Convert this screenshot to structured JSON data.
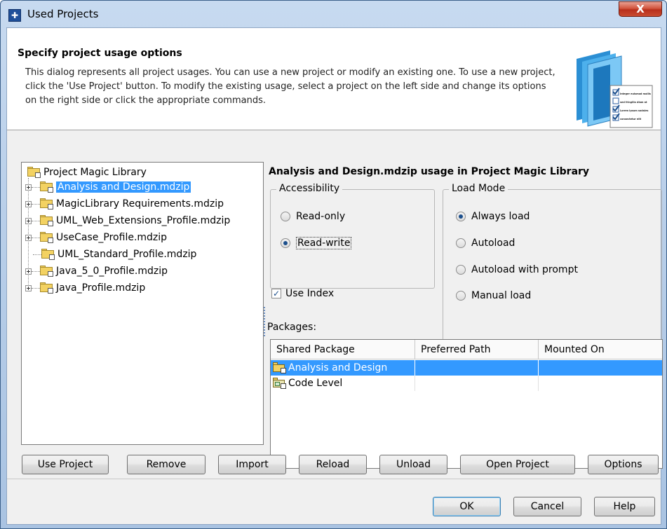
{
  "window": {
    "title": "Used Projects",
    "close_label": "X"
  },
  "header": {
    "title": "Specify project usage options",
    "description": "This dialog represents all project usages. You can use a new project or modify an existing one. To use a new project, click the 'Use Project' button. To modify the existing usage, select a project on the left side and change its options on the right side or click the appropriate commands."
  },
  "tree": {
    "root": "Project Magic Library",
    "items": [
      {
        "label": "Analysis and Design.mdzip",
        "selected": true,
        "expandable": true
      },
      {
        "label": "MagicLibrary Requirements.mdzip",
        "selected": false,
        "expandable": true
      },
      {
        "label": "UML_Web_Extensions_Profile.mdzip",
        "selected": false,
        "expandable": true
      },
      {
        "label": "UseCase_Profile.mdzip",
        "selected": false,
        "expandable": true
      },
      {
        "label": "UML_Standard_Profile.mdzip",
        "selected": false,
        "expandable": false
      },
      {
        "label": "Java_5_0_Profile.mdzip",
        "selected": false,
        "expandable": true
      },
      {
        "label": "Java_Profile.mdzip",
        "selected": false,
        "expandable": true
      }
    ]
  },
  "usage": {
    "title": "Analysis and Design.mdzip usage in Project Magic Library",
    "accessibility": {
      "legend": "Accessibility",
      "options": [
        "Read-only",
        "Read-write"
      ],
      "selected": "Read-write"
    },
    "load_mode": {
      "legend": "Load Mode",
      "options": [
        "Always load",
        "Autoload",
        "Autoload with prompt",
        "Manual load"
      ],
      "selected": "Always load"
    },
    "use_index": {
      "label": "Use Index",
      "checked": true
    },
    "packages_label": "Packages:",
    "packages": {
      "columns": [
        "Shared Package",
        "Preferred Path",
        "Mounted On"
      ],
      "rows": [
        {
          "name": "Analysis and Design",
          "path": "",
          "mounted": "",
          "selected": true
        },
        {
          "name": "Code Level",
          "path": "",
          "mounted": "",
          "selected": false
        }
      ]
    }
  },
  "header_art": {
    "checklist": [
      "Integer euismod mollis",
      "sed fringilla diam at",
      "Lorem ipsum sodales",
      "consectetur elit"
    ]
  },
  "actions": {
    "use_project": "Use Project",
    "remove": "Remove",
    "import": "Import",
    "reload": "Reload",
    "unload": "Unload",
    "open_project": "Open Project",
    "options": "Options"
  },
  "footer": {
    "ok": "OK",
    "cancel": "Cancel",
    "help": "Help"
  },
  "colors": {
    "selection": "#3399ff",
    "title_gradient_top": "#c7daf0",
    "close_button": "#c94a30"
  }
}
